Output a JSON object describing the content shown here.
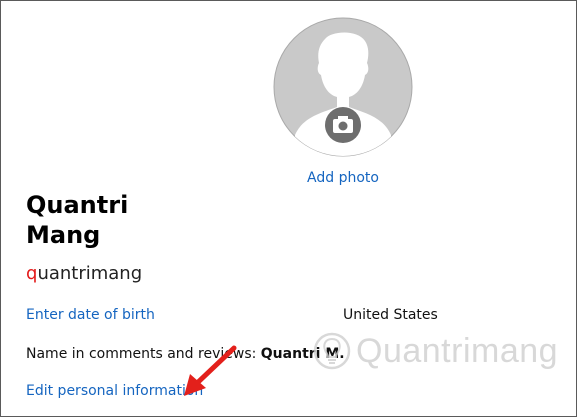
{
  "profile": {
    "add_photo_label": "Add photo",
    "first_name": "Quantri",
    "last_name": "Mang",
    "login_first_char": "q",
    "login_rest": "uantrimang",
    "dob_link": "Enter date of birth",
    "country": "United States",
    "comments_label": "Name in comments and reviews: ",
    "comments_name": "Quantri M.",
    "edit_link": "Edit personal information"
  },
  "watermark": {
    "text": "Quantrimang",
    "icon": "lightbulb-icon"
  },
  "annotation": {
    "arrow_color": "#e3201b"
  },
  "colors": {
    "link": "#1565c0",
    "avatar_bg": "#c8c8c8",
    "login_accent": "#e31b1b"
  }
}
